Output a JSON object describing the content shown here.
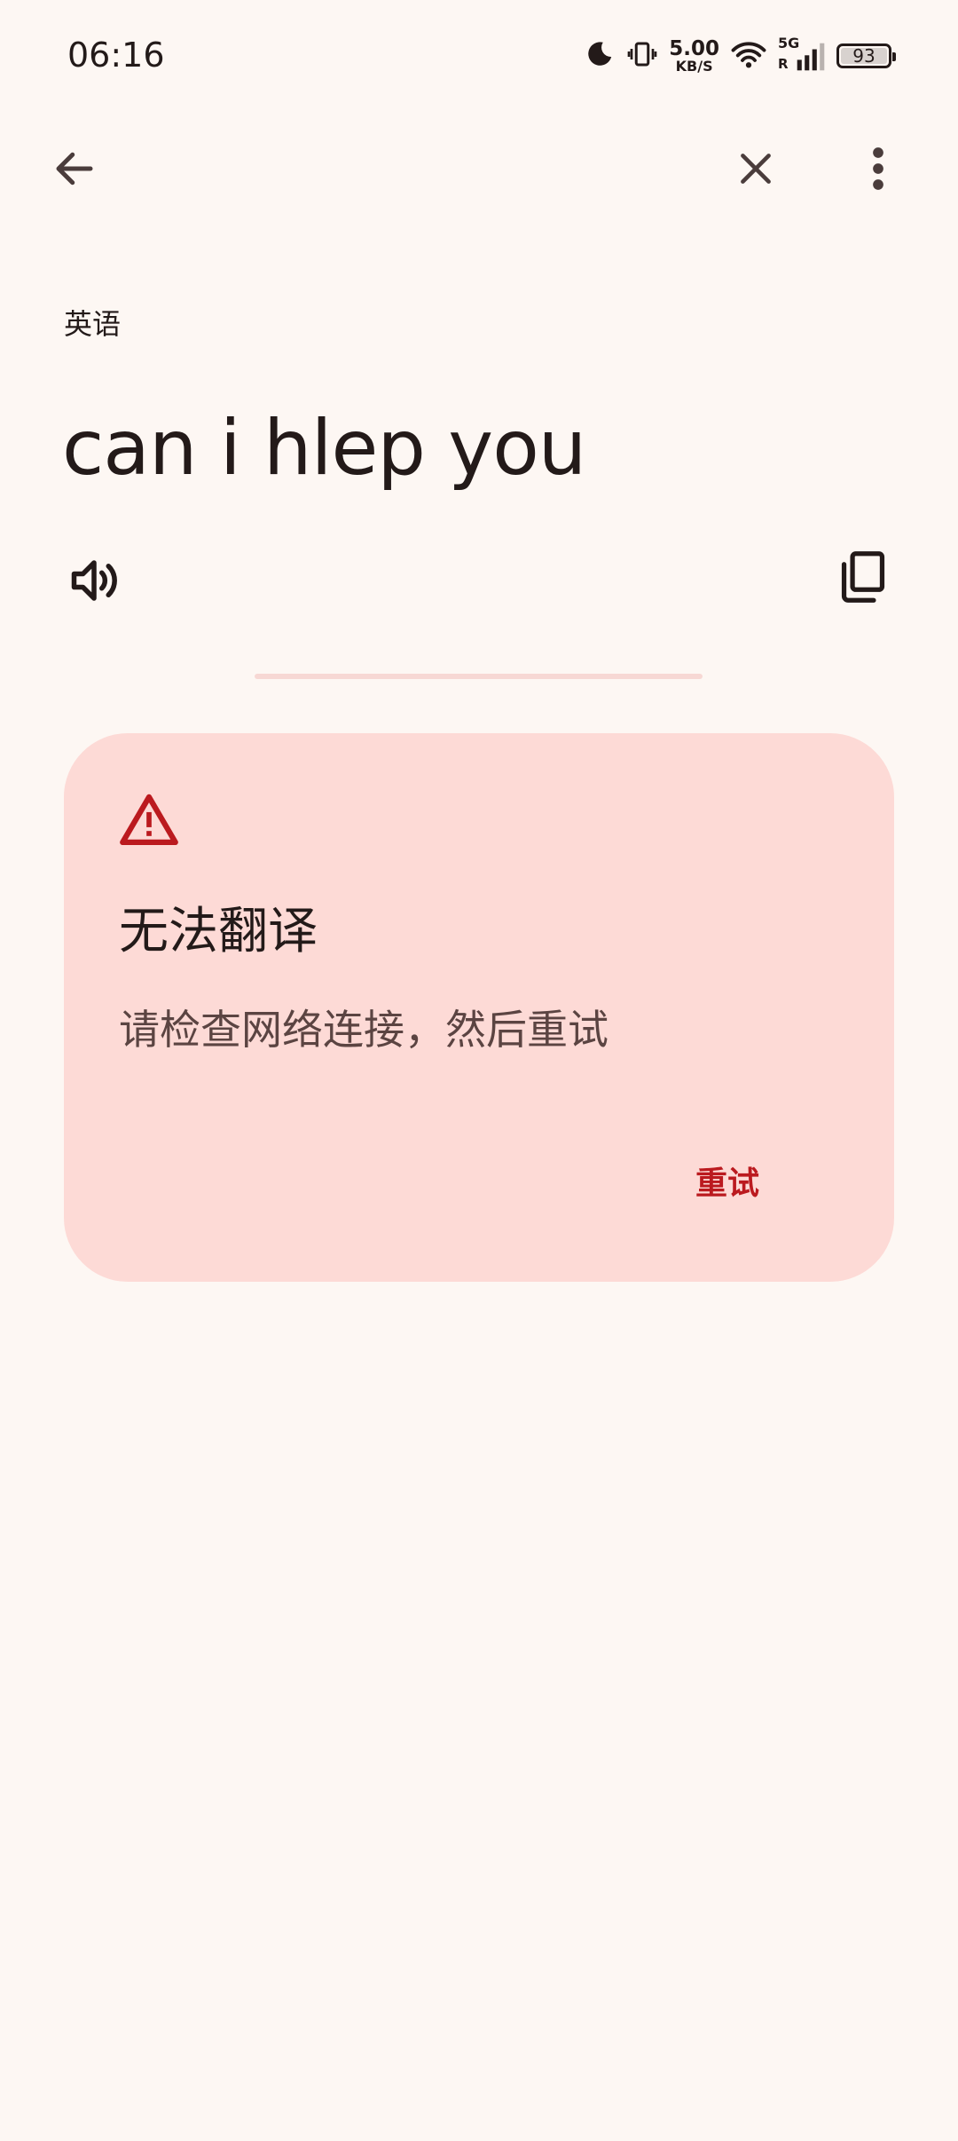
{
  "status_bar": {
    "time": "06:16",
    "net_speed_value": "5.00",
    "net_speed_unit": "KB/S",
    "network_type": "5G",
    "roaming": "R",
    "battery": "93",
    "icons": [
      "moon-icon",
      "vibrate-icon",
      "wifi-icon",
      "signal-icon",
      "battery-icon"
    ]
  },
  "toolbar": {
    "back_icon": "arrow-left-icon",
    "clear_icon": "close-icon",
    "more_icon": "more-vert-icon"
  },
  "source": {
    "language": "英语",
    "text": "can i hlep you"
  },
  "error_card": {
    "title": "无法翻译",
    "message": "请检查网络连接，然后重试",
    "retry_label": "重试"
  },
  "colors": {
    "background": "#fdf7f3",
    "card_background": "#fddad6",
    "accent_red": "#bb1a1f",
    "text_primary": "#231a19",
    "text_secondary": "#5b4442"
  }
}
